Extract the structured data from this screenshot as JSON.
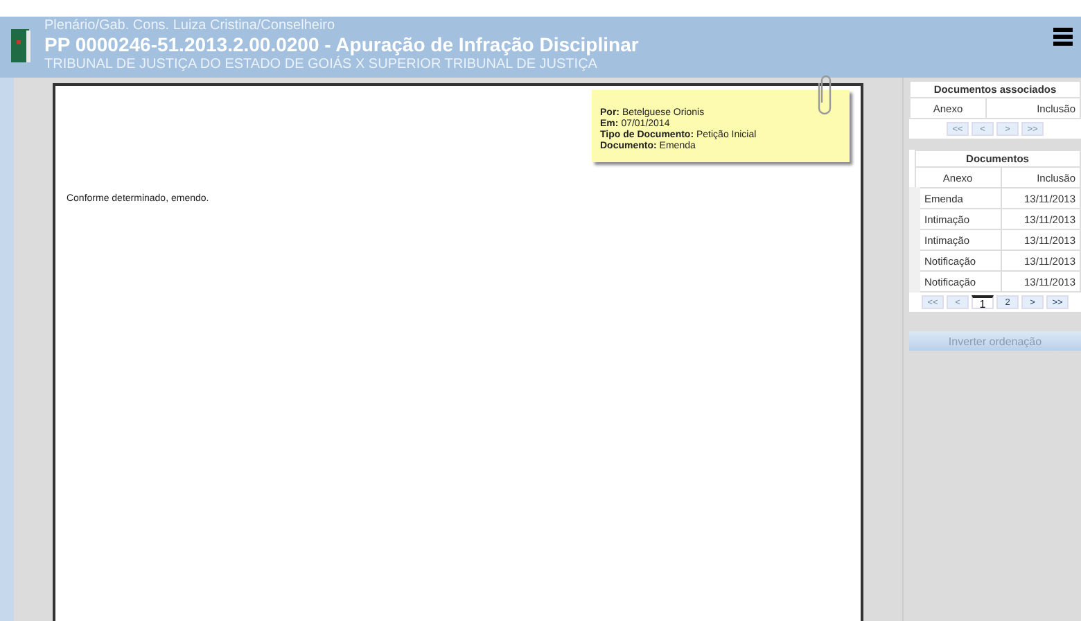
{
  "header": {
    "breadcrumb": "Plenário/Gab. Cons. Luiza Cristina/Conselheiro",
    "title": "PP 0000246-51.2013.2.00.0200 - Apuração de Infração Disciplinar",
    "subtitle": "TRIBUNAL DE JUSTIÇA DO ESTADO DE GOIÁS X SUPERIOR TRIBUNAL DE JUSTIÇA"
  },
  "note": {
    "fields": [
      {
        "label": "Por:",
        "value": "Betelguese Orionis"
      },
      {
        "label": "Em:",
        "value": "07/01/2014"
      },
      {
        "label": "Tipo de Documento:",
        "value": "Petição Inicial"
      },
      {
        "label": "Documento:",
        "value": "Emenda"
      }
    ]
  },
  "document": {
    "text": "Conforme determinado, emendo."
  },
  "associated": {
    "title": "Documentos associados",
    "columns": [
      "Anexo",
      "Inclusão"
    ],
    "pager": [
      {
        "label": "<<",
        "kind": "nav",
        "disabled": true
      },
      {
        "label": "<",
        "kind": "nav",
        "disabled": true
      },
      {
        "label": ">",
        "kind": "nav",
        "disabled": true
      },
      {
        "label": ">>",
        "kind": "nav",
        "disabled": true
      }
    ]
  },
  "documents": {
    "title": "Documentos",
    "columns": [
      "Anexo",
      "Inclusão"
    ],
    "rows": [
      {
        "anexo": "Emenda",
        "inclusao": "13/11/2013"
      },
      {
        "anexo": "Intimação",
        "inclusao": "13/11/2013"
      },
      {
        "anexo": "Intimação",
        "inclusao": "13/11/2013"
      },
      {
        "anexo": "Notificação",
        "inclusao": "13/11/2013"
      },
      {
        "anexo": "Notificação",
        "inclusao": "13/11/2013"
      }
    ],
    "pager": [
      {
        "label": "<<",
        "kind": "nav",
        "disabled": true
      },
      {
        "label": "<",
        "kind": "nav",
        "disabled": true
      },
      {
        "label": "1",
        "kind": "page",
        "selected": true
      },
      {
        "label": "2",
        "kind": "page",
        "selected": false
      },
      {
        "label": ">",
        "kind": "nav",
        "disabled": false
      },
      {
        "label": ">>",
        "kind": "nav",
        "disabled": false
      }
    ]
  },
  "invert_button": "Inverter ordenação"
}
